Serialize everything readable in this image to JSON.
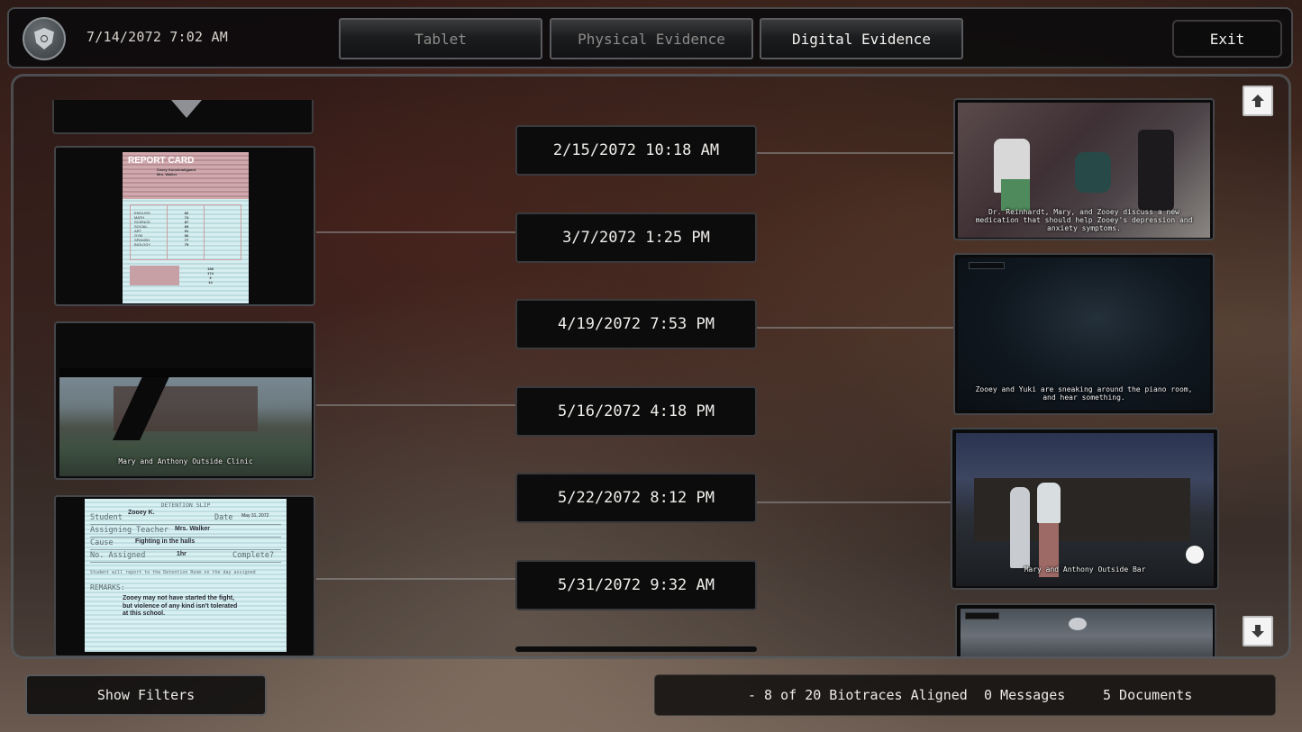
{
  "header": {
    "clock": "7/14/2072 7:02 AM",
    "tabs": [
      {
        "label": "Tablet",
        "active": false
      },
      {
        "label": "Physical Evidence",
        "active": false
      },
      {
        "label": "Digital Evidence",
        "active": true
      }
    ],
    "exit_label": "Exit"
  },
  "timeline": {
    "dates": [
      "2/15/2072 10:18 AM",
      "3/7/2072 1:25 PM",
      "4/19/2072 7:53 PM",
      "5/16/2072 4:18 PM",
      "5/22/2072 8:12 PM",
      "5/31/2072 9:32 AM"
    ]
  },
  "left_evidence": {
    "report_card": {
      "title": "REPORT CARD",
      "student": "Zooey Kunstmatigaard",
      "teacher": "Mrs. Walker",
      "subjects": [
        "ENGLISH",
        "MATH",
        "SCIENCE",
        "SOCIAL",
        "ART",
        "GYM",
        "SPANISH",
        "BIOLOGY"
      ],
      "grades": [
        "82",
        "74",
        "87",
        "69",
        "91",
        "66",
        "77",
        "79"
      ],
      "totals": [
        "158",
        "174",
        "3",
        "14"
      ]
    },
    "clinic_scene": {
      "caption": "Mary and Anthony Outside Clinic"
    },
    "detention_slip": {
      "title": "DETENTION SLIP",
      "student_label": "Student",
      "student_value": "Zooey K.",
      "date_label": "Date",
      "date_value": "May 31, 2072",
      "teacher_label": "Assigning Teacher",
      "teacher_value": "Mrs. Walker",
      "cause_label": "Cause",
      "cause_value": "Fighting in the halls",
      "assigned_label": "No. Assigned",
      "assigned_value": "1hr",
      "complete_label": "Complete?",
      "notice": "Student will report to the Detention Room on the day assigned",
      "remarks_label": "REMARKS:",
      "remarks_value": "Zooey may not have started the fight, but violence of any kind isn't tolerated at this school."
    }
  },
  "right_evidence": {
    "scenes": [
      {
        "caption": "Dr. Reinhardt, Mary, and Zooey discuss a new medication that should help Zooey's depression and anxiety symptoms."
      },
      {
        "caption": "Zooey and Yuki are sneaking around the piano room, and hear something."
      },
      {
        "caption": "Mary and Anthony Outside Bar"
      },
      {
        "caption": ""
      }
    ]
  },
  "footer": {
    "filters_label": "Show Filters",
    "biotraces": "- 8 of 20 Biotraces Aligned",
    "messages": "0 Messages",
    "documents": "5 Documents"
  }
}
